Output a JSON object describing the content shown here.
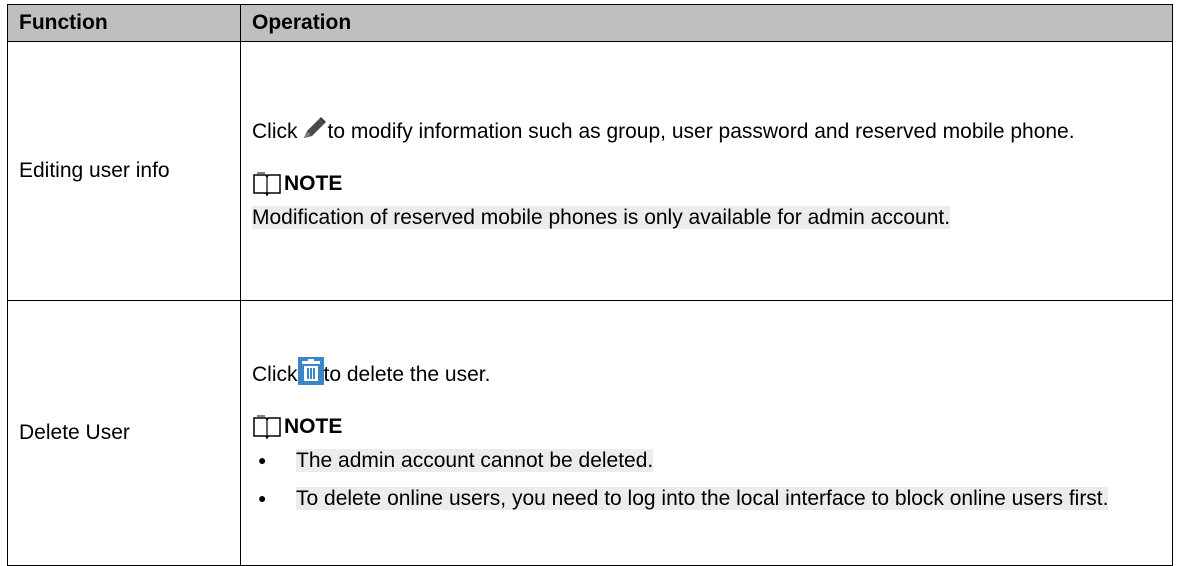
{
  "table": {
    "headers": [
      "Function",
      "Operation"
    ],
    "rows": [
      {
        "function": "Editing user info",
        "click": "Click",
        "text_after_icon": "to modify information such as group, user password and reserved mobile phone.",
        "note_label": "NOTE",
        "note_text": "Modification of reserved mobile phones is only available for admin account."
      },
      {
        "function": "Delete User",
        "click": "Click",
        "text_after_icon": "to delete the user.",
        "note_label": "NOTE",
        "bullets": [
          "The admin account cannot be deleted.",
          "To delete online users, you need to log into the local interface to block online users first."
        ]
      }
    ]
  },
  "icons": {
    "edit": "pencil-icon",
    "delete": "trash-icon",
    "note": "book-icon"
  }
}
